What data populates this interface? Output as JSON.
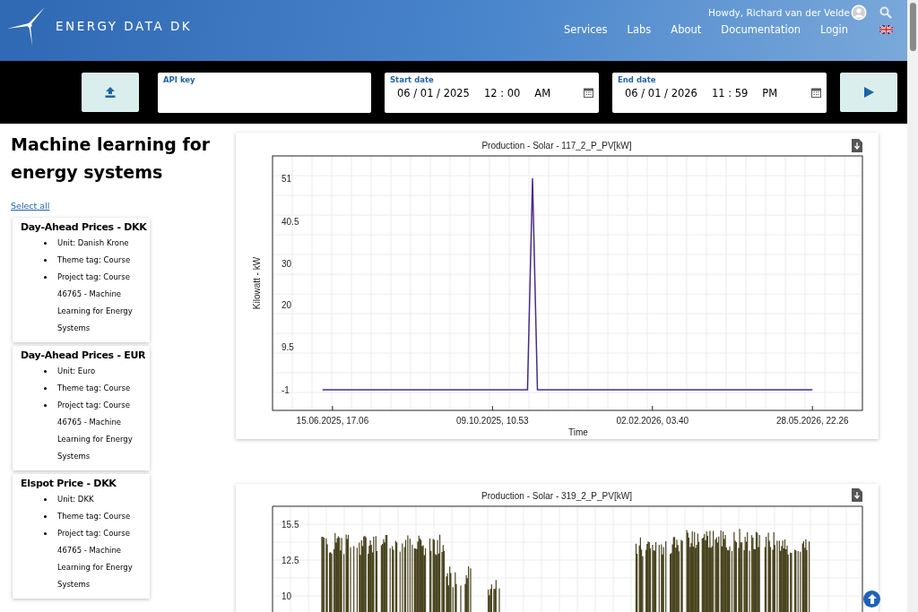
{
  "header": {
    "logo_text": "ENERGY DATA DK",
    "greeting": "Howdy, Richard van der Velde",
    "nav": [
      "Services",
      "Labs",
      "About",
      "Documentation",
      "Login"
    ]
  },
  "toolbar": {
    "api_key": {
      "label": "API key"
    },
    "start_date": {
      "label": "Start date",
      "date": "06 / 01 / 2025",
      "time": "12 : 00",
      "period": "AM"
    },
    "end_date": {
      "label": "End date",
      "date": "06 / 01 / 2026",
      "time": "11 : 59",
      "period": "PM"
    }
  },
  "sidebar": {
    "title": "Machine learning for energy systems",
    "select_all": "Select all",
    "datasets": [
      {
        "title": "Day-Ahead Prices - DKK",
        "tags": [
          "Unit: Danish Krone",
          "Theme tag: Course",
          "Project tag: Course 46765 - Machine Learning for Energy Systems"
        ]
      },
      {
        "title": "Day-Ahead Prices - EUR",
        "tags": [
          "Unit: Euro",
          "Theme tag: Course",
          "Project tag: Course 46765 - Machine Learning for Energy Systems"
        ]
      },
      {
        "title": "Elspot Price - DKK",
        "tags": [
          "Unit: DKK",
          "Theme tag: Course",
          "Project tag: Course 46765 - Machine Learning for Energy Systems"
        ]
      }
    ]
  },
  "charts": [
    {
      "chart_data": {
        "type": "line",
        "title": "Production - Solar - 117_2_P_PV[kW]",
        "xlabel": "Time",
        "ylabel": "Kilowatt - kW",
        "categories": [
          null,
          null,
          "15.06.2025, 17.06",
          null,
          null,
          null,
          null,
          null,
          null,
          null,
          null,
          null,
          null,
          null,
          null,
          null,
          null,
          null,
          null,
          null,
          null,
          null,
          null,
          null,
          null,
          null,
          null,
          null,
          null,
          null,
          null,
          null,
          null,
          null,
          "09.10.2025, 10.53",
          null,
          null,
          null,
          null,
          null,
          null,
          null,
          null,
          null,
          null,
          null,
          null,
          null,
          null,
          null,
          null,
          null,
          null,
          null,
          null,
          null,
          null,
          null,
          null,
          null,
          null,
          null,
          null,
          null,
          null,
          null,
          "02.02.2026, 03.40",
          null,
          null,
          null,
          null,
          null,
          null,
          null,
          null,
          null,
          null,
          null,
          null,
          null,
          null,
          null,
          null,
          null,
          null,
          null,
          null,
          null,
          null,
          null,
          null,
          null,
          null,
          null,
          null,
          null,
          null,
          null,
          "28.05.2026, 22.26"
        ],
        "series": [
          {
            "color": "#4b2a8a",
            "values": [
              -1,
              -1,
              -1,
              -1,
              -1,
              -1,
              -1,
              -1,
              -1,
              -1,
              -1,
              -1,
              -1,
              -1,
              -1,
              -1,
              -1,
              -1,
              -1,
              -1,
              -1,
              -1,
              -1,
              -1,
              -1,
              -1,
              -1,
              -1,
              -1,
              -1,
              -1,
              -1,
              -1,
              -1,
              -1,
              -1,
              -1,
              -1,
              -1,
              -1,
              -1,
              -1,
              51,
              -1,
              -1,
              -1,
              -1,
              -1,
              -1,
              -1,
              -1,
              -1,
              -1,
              -1,
              -1,
              -1,
              -1,
              -1,
              -1,
              -1,
              -1,
              -1,
              -1,
              -1,
              -1,
              -1,
              -1,
              -1,
              -1,
              -1,
              -1,
              -1,
              -1,
              -1,
              -1,
              -1,
              -1,
              -1,
              -1,
              -1,
              -1,
              -1,
              -1,
              -1,
              -1,
              -1,
              -1,
              -1,
              -1,
              -1,
              -1,
              -1,
              -1,
              -1,
              -1,
              -1,
              -1,
              -1,
              -1
            ]
          }
        ],
        "grid": true,
        "ylim": [
          -6.1,
          56.5
        ],
        "yticks": [
          -1,
          9.5,
          20,
          30,
          40.5,
          51
        ]
      }
    },
    {
      "title": "Production - Solar - 319_2_P_PV[kW]",
      "y_tick_labels": [
        "15.5",
        "12.5",
        "10"
      ]
    }
  ]
}
